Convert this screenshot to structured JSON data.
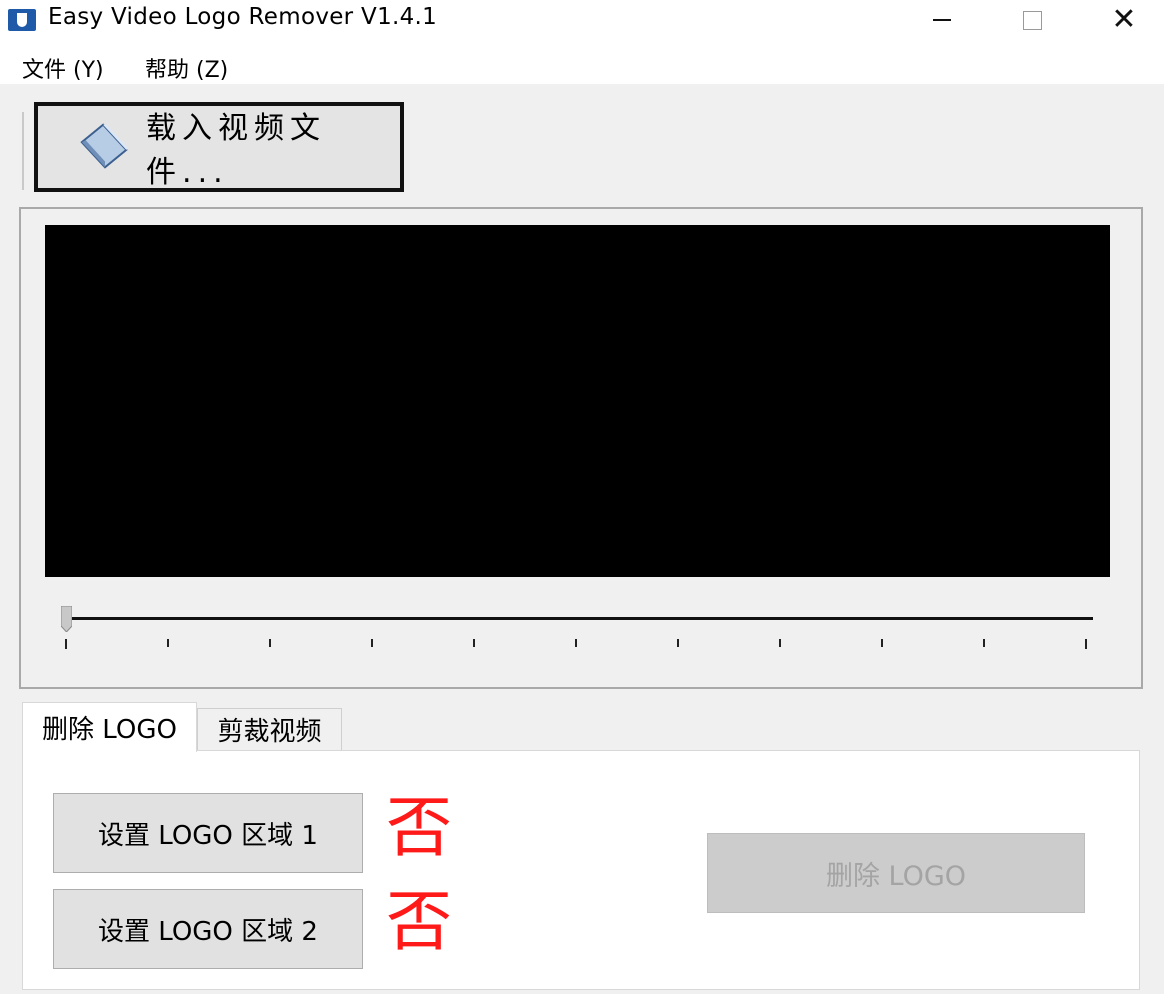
{
  "window": {
    "title": "Easy Video Logo Remover V1.4.1",
    "app_icon": "app-icon",
    "controls": {
      "minimize": "minimize-icon",
      "maximize": "maximize-icon",
      "close": "close-icon"
    }
  },
  "menu": {
    "file": "文件 (Y)",
    "help": "帮助 (Z)"
  },
  "toolbar": {
    "load_label": "载入视频文件...",
    "load_icon": "folder-icon"
  },
  "player": {
    "slider_position": 0,
    "tick_count": 11
  },
  "tabs": [
    {
      "label": "删除 LOGO",
      "active": true
    },
    {
      "label": "剪裁视频",
      "active": false
    }
  ],
  "logo_panel": {
    "area1_label": "设置 LOGO 区域 1",
    "area1_status": "否",
    "area2_label": "设置 LOGO 区域 2",
    "area2_status": "否",
    "delete_label": "删除 LOGO",
    "status_color": "#ff1a1a"
  }
}
